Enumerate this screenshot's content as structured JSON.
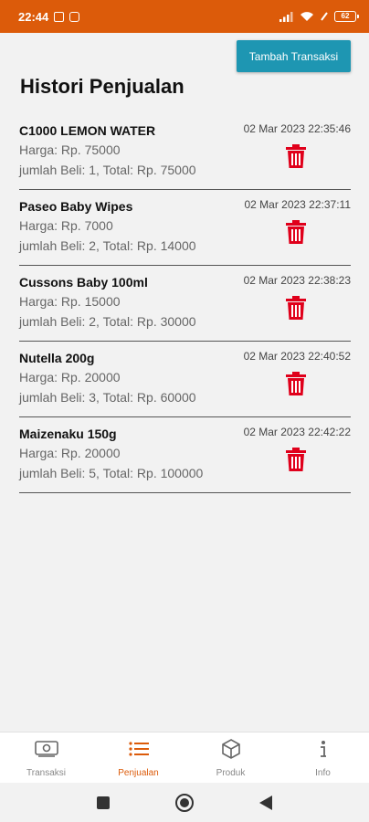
{
  "status_bar": {
    "time": "22:44",
    "battery": "62"
  },
  "header": {
    "add_button_label": "Tambah Transaksi",
    "title": "Histori Penjualan"
  },
  "transactions": [
    {
      "name": "C1000 LEMON WATER",
      "date": "02 Mar 2023 22:35:46",
      "price": "Harga: Rp. 75000",
      "qty_total": "jumlah Beli: 1, Total: Rp. 75000"
    },
    {
      "name": "Paseo Baby Wipes",
      "date": "02 Mar 2023 22:37:11",
      "price": "Harga: Rp. 7000",
      "qty_total": "jumlah Beli: 2, Total: Rp. 14000"
    },
    {
      "name": "Cussons Baby 100ml",
      "date": "02 Mar 2023 22:38:23",
      "price": "Harga: Rp. 15000",
      "qty_total": "jumlah Beli: 2, Total: Rp. 30000"
    },
    {
      "name": "Nutella 200g",
      "date": "02 Mar 2023 22:40:52",
      "price": "Harga: Rp. 20000",
      "qty_total": "jumlah Beli: 3, Total: Rp. 60000"
    },
    {
      "name": "Maizenaku 150g",
      "date": "02 Mar 2023 22:42:22",
      "price": "Harga: Rp. 20000",
      "qty_total": "jumlah Beli: 5, Total: Rp. 100000"
    }
  ],
  "bottom_nav": [
    {
      "label": "Transaksi",
      "icon": "money-icon",
      "active": false
    },
    {
      "label": "Penjualan",
      "icon": "list-icon",
      "active": true
    },
    {
      "label": "Produk",
      "icon": "box-icon",
      "active": false
    },
    {
      "label": "Info",
      "icon": "info-icon",
      "active": false
    }
  ],
  "colors": {
    "status_bar": "#dc5b0a",
    "accent": "#dc5b0a",
    "button": "#1e96b2",
    "delete": "#e0001b"
  }
}
